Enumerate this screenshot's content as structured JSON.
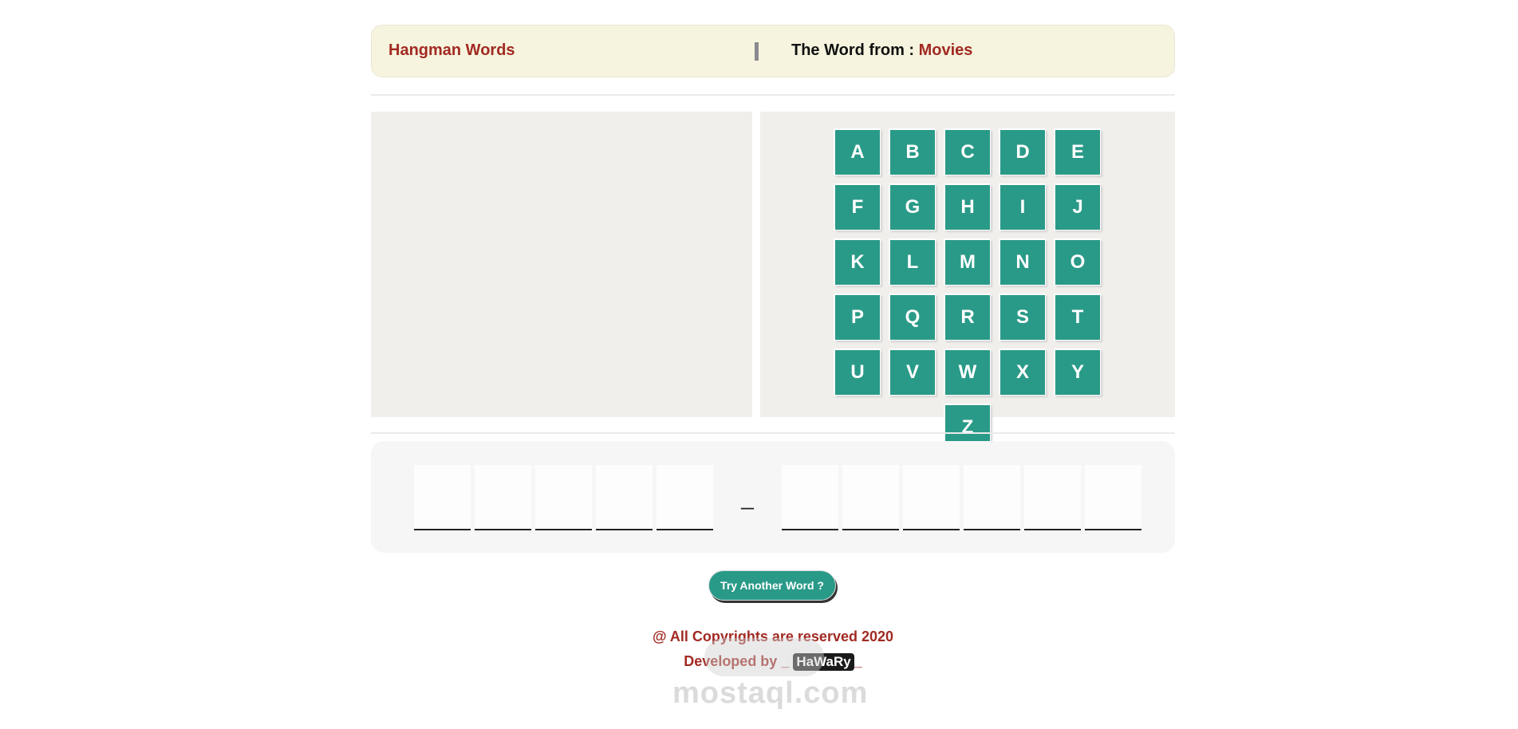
{
  "header": {
    "title": "Hangman Words",
    "word_from_label": "The Word from : ",
    "category": "Movies"
  },
  "letters": [
    "A",
    "B",
    "C",
    "D",
    "E",
    "F",
    "G",
    "H",
    "I",
    "J",
    "K",
    "L",
    "M",
    "N",
    "O",
    "P",
    "Q",
    "R",
    "S",
    "T",
    "U",
    "V",
    "W",
    "X",
    "Y",
    "Z"
  ],
  "guess": {
    "first_word_slots": 5,
    "separator": "_",
    "second_word_slots": 6
  },
  "button": {
    "label": "Try Another Word ?"
  },
  "footer": {
    "copyright": "@ All Copyrights are reserved 2020",
    "developed_by": "Developed by _",
    "author": "HaWaRy",
    "trail": "_"
  },
  "watermark": {
    "text": "mostaql.com"
  },
  "colors": {
    "accent": "#2a9a88",
    "brand": "#a12a22",
    "header_bg": "#f6f4de",
    "panel_bg": "#f0efeb"
  }
}
